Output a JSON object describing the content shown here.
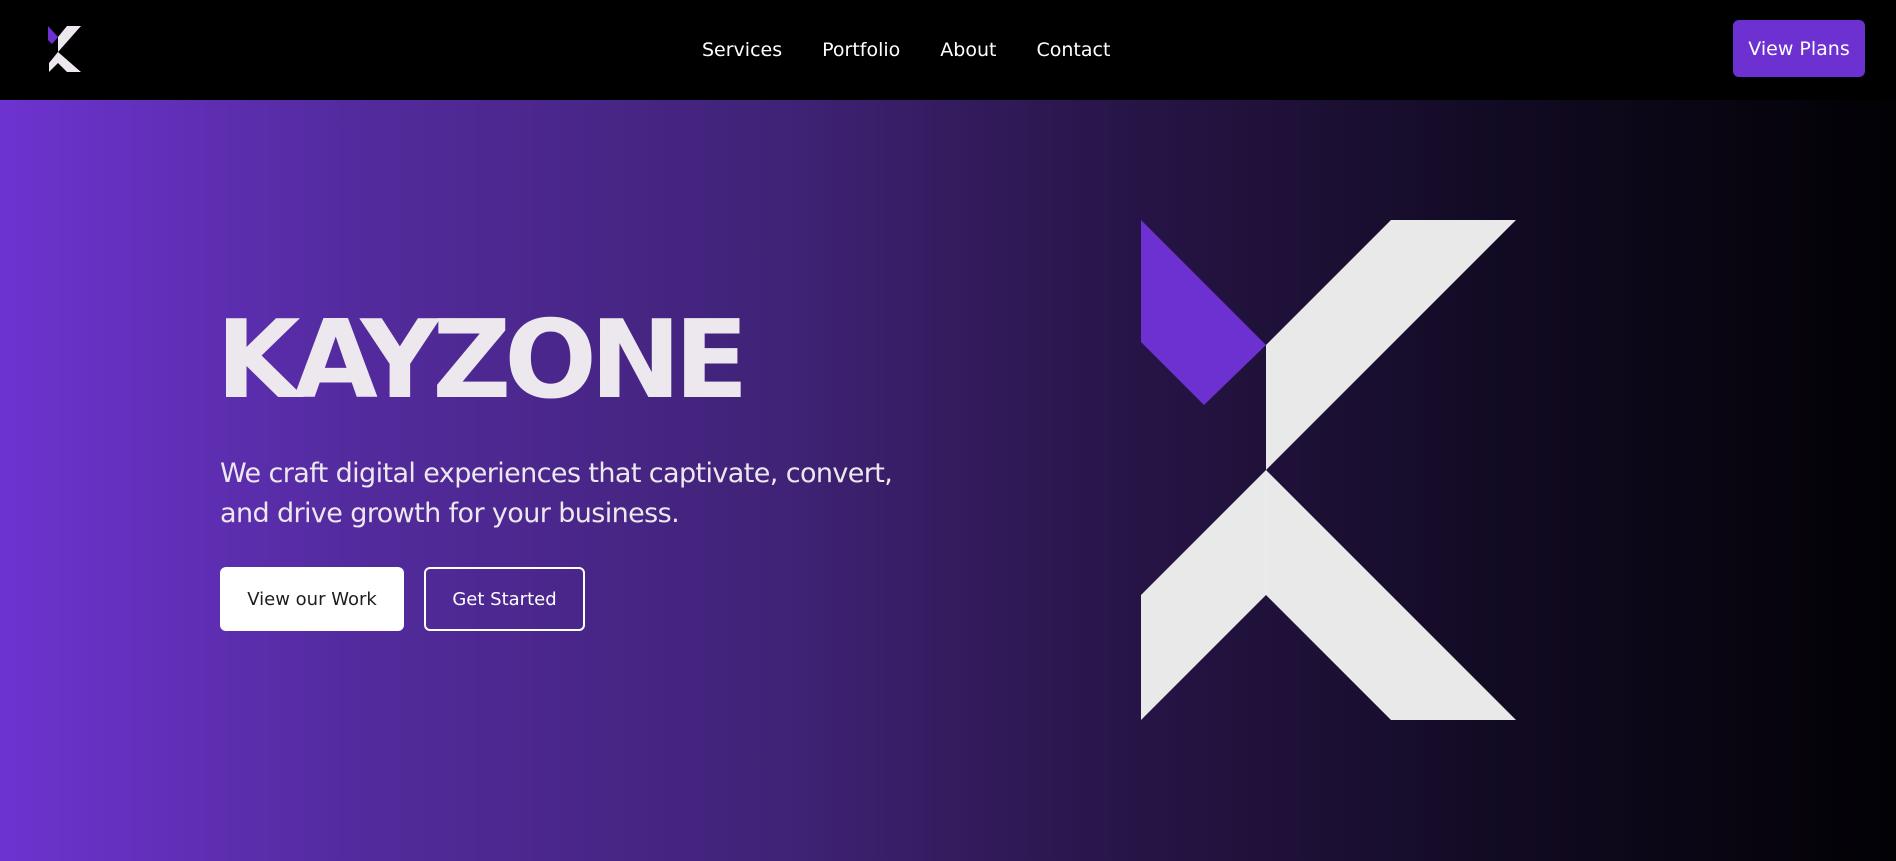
{
  "brand": {
    "logo_icon": "kayzone-x-logo-icon",
    "name": "KAYZONE",
    "accent_color": "#6d30d1",
    "light_color": "#ece8ee"
  },
  "nav": {
    "items": [
      "Services",
      "Portfolio",
      "About",
      "Contact"
    ],
    "cta_label": "View Plans"
  },
  "hero": {
    "title": "KAYZONE",
    "subtitle": "We craft digital experiences that captivate, convert, and drive growth for your business.",
    "primary_label": "View our Work",
    "secondary_label": "Get Started",
    "art_icon": "large-kayzone-x-logo-icon"
  }
}
